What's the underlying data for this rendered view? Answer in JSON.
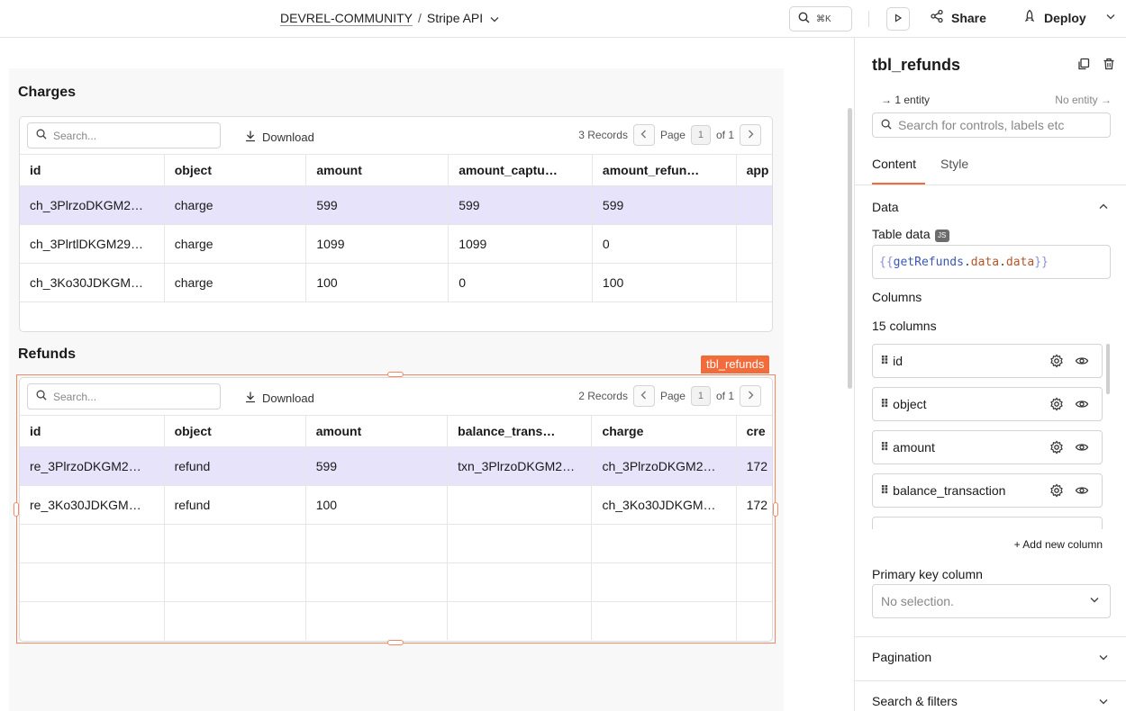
{
  "topbar": {
    "workspace": "DEVREL-COMMUNITY",
    "separator": "/",
    "app_name": "Stripe API",
    "search_shortcut": "⌘K",
    "share_label": "Share",
    "deploy_label": "Deploy"
  },
  "charges": {
    "title": "Charges",
    "search_placeholder": "Search...",
    "download_label": "Download",
    "records": "3 Records",
    "page_label": "Page",
    "page": "1",
    "of_label": "of 1",
    "columns": [
      "id",
      "object",
      "amount",
      "amount_captu…",
      "amount_refun…",
      "app"
    ],
    "rows": [
      [
        "ch_3PlrzoDKGM2…",
        "charge",
        "599",
        "599",
        "599",
        ""
      ],
      [
        "ch_3PlrtlDKGM29…",
        "charge",
        "1099",
        "1099",
        "0",
        ""
      ],
      [
        "ch_3Ko30JDKGM…",
        "charge",
        "100",
        "0",
        "100",
        ""
      ]
    ]
  },
  "refunds": {
    "title": "Refunds",
    "tag": "tbl_refunds",
    "search_placeholder": "Search...",
    "download_label": "Download",
    "records": "2 Records",
    "page_label": "Page",
    "page": "1",
    "of_label": "of 1",
    "columns": [
      "id",
      "object",
      "amount",
      "balance_trans…",
      "charge",
      "cre"
    ],
    "rows": [
      [
        "re_3PlrzoDKGM2…",
        "refund",
        "599",
        "txn_3PlrzoDKGM2…",
        "ch_3PlrzoDKGM2…",
        "172"
      ],
      [
        "re_3Ko30JDKGM…",
        "refund",
        "100",
        "",
        "ch_3Ko30JDKGM…",
        "172"
      ],
      [
        "",
        "",
        "",
        "",
        "",
        ""
      ],
      [
        "",
        "",
        "",
        "",
        "",
        ""
      ],
      [
        "",
        "",
        "",
        "",
        "",
        ""
      ]
    ]
  },
  "panel": {
    "title": "tbl_refunds",
    "entity_in": "→ 1 entity",
    "entity_out": "No entity →",
    "search_placeholder": "Search for controls, labels etc",
    "tab_content": "Content",
    "tab_style": "Style",
    "data_section": "Data",
    "table_data_label": "Table data",
    "js_badge": "JS",
    "code_open": "{{",
    "code_fn": "getRefunds",
    "code_dot1": ".",
    "code_prop1": "data",
    "code_dot2": ".",
    "code_prop2": "data",
    "code_close": "}}",
    "columns_label": "Columns",
    "columns_count": "15 columns",
    "column_items": [
      "id",
      "object",
      "amount",
      "balance_transaction"
    ],
    "add_column": "+ Add new column",
    "primary_key_label": "Primary key column",
    "primary_key_value": "No selection.",
    "pagination_label": "Pagination",
    "search_filters_label": "Search & filters"
  },
  "colors": {
    "accent": "#f26b3a",
    "selected_row": "#e6e3fb"
  }
}
